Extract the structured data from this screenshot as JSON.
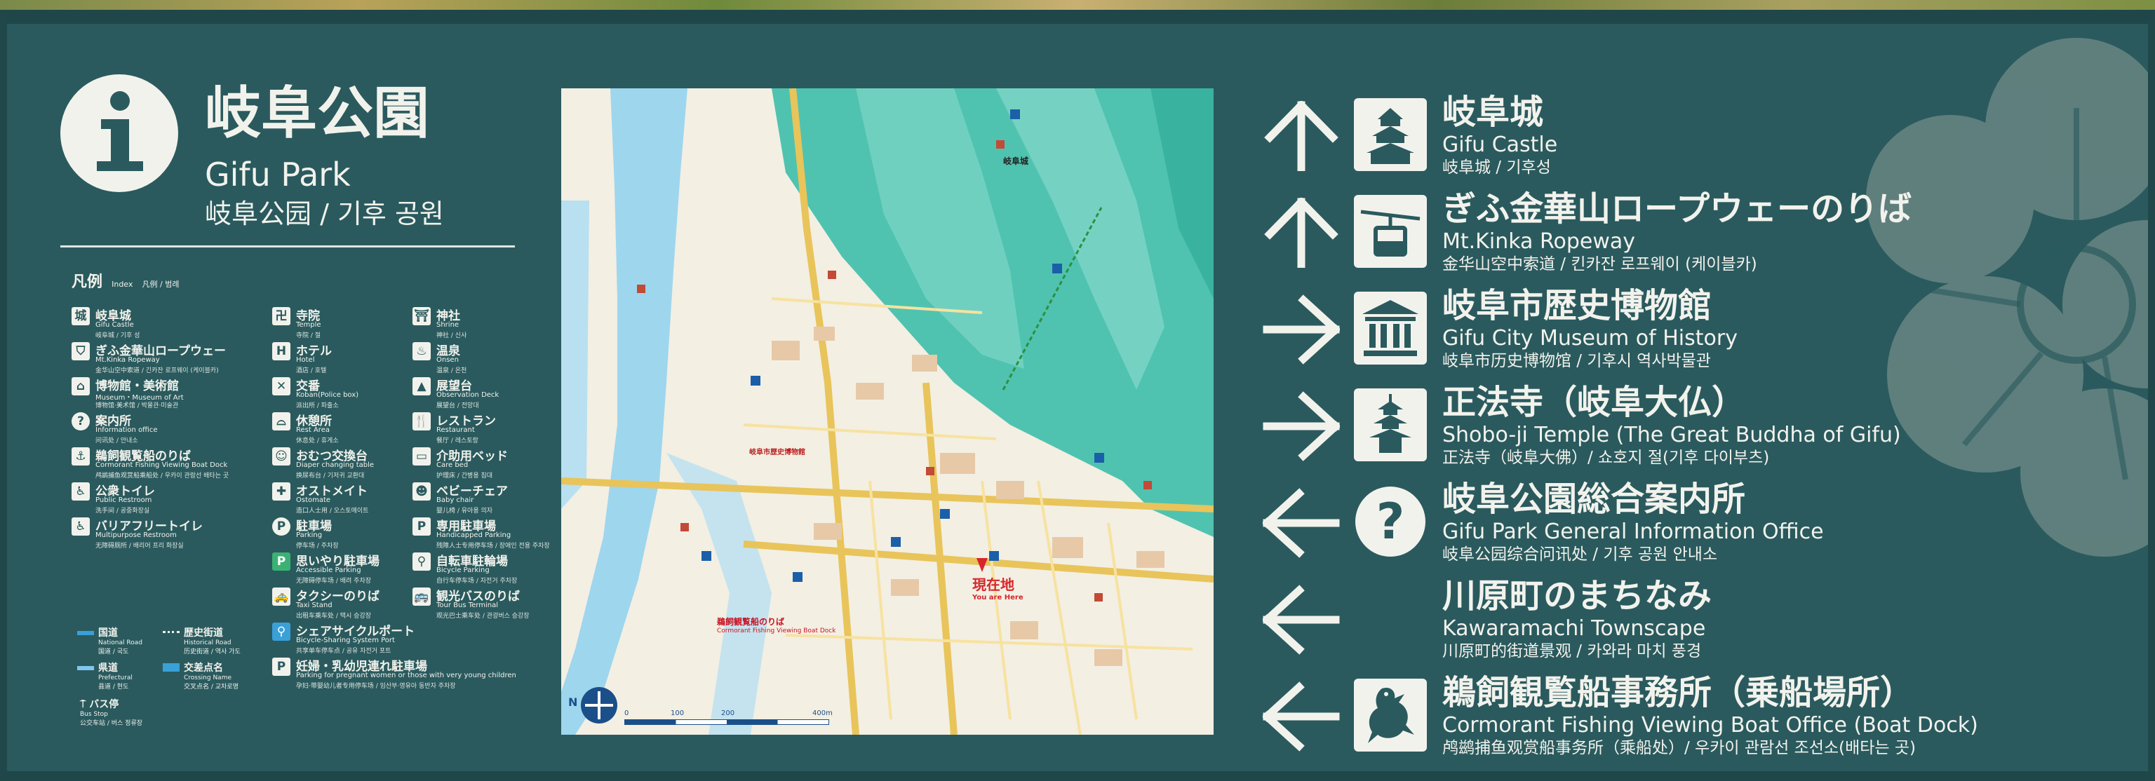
{
  "header": {
    "title_jp": "岐阜公園",
    "title_en": "Gifu Park",
    "title_sub": "岐阜公园 / 기후 공원"
  },
  "legend": {
    "heading": "凡例",
    "heading_en": "Index",
    "heading_ml": "凡例 / 범례",
    "items": [
      {
        "jp": "岐阜城",
        "en": "Gifu Castle",
        "ml": "岐阜城 / 기후 성"
      },
      {
        "jp": "ぎふ金華山ロープウェー",
        "en": "Mt.Kinka Ropeway",
        "ml": "金华山空中索道 / 긴카잔 로프웨이 (케이블카)"
      },
      {
        "jp": "博物館・美術館",
        "en": "Museum・Museum of Art",
        "ml": "博物馆·美术馆 / 박물관·미술관"
      },
      {
        "jp": "案内所",
        "en": "Information office",
        "ml": "问讯处 / 안내소"
      },
      {
        "jp": "鵜飼観覧船のりば",
        "en": "Cormorant Fishing Viewing Boat Dock",
        "ml": "鸬鹚捕鱼观赏船乘船处 / 우카이 관람선 배타는 곳"
      },
      {
        "jp": "公衆トイレ",
        "en": "Public Restroom",
        "ml": "洗手间 / 공중화장실"
      },
      {
        "jp": "バリアフリートイレ",
        "en": "Multipurpose Restroom",
        "ml": "无障碍厕所 / 배리어 프리 화장실"
      },
      {
        "jp": "寺院",
        "en": "Temple",
        "ml": "寺院 / 절"
      },
      {
        "jp": "ホテル",
        "en": "Hotel",
        "ml": "酒店 / 호텔"
      },
      {
        "jp": "交番",
        "en": "Koban(Police box)",
        "ml": "派出所 / 파출소"
      },
      {
        "jp": "休憩所",
        "en": "Rest Area",
        "ml": "休息处 / 휴게소"
      },
      {
        "jp": "おむつ交換台",
        "en": "Diaper changing table",
        "ml": "换尿布台 / 기저귀 교환대"
      },
      {
        "jp": "オストメイト",
        "en": "Ostomate",
        "ml": "造口人士用 / 오스토메이트"
      },
      {
        "jp": "駐車場",
        "en": "Parking",
        "ml": "停车场 / 주차장"
      },
      {
        "jp": "思いやり駐車場",
        "en": "Accessible Parking",
        "ml": "无障碍停车场 / 배려 주차장"
      },
      {
        "jp": "タクシーのりば",
        "en": "Taxi Stand",
        "ml": "出租车乘车处 / 택시 승강장"
      },
      {
        "jp": "シェアサイクルポート",
        "en": "Bicycle-Sharing System Port",
        "ml": "共享单车停车点 / 공유 자전거 포트"
      },
      {
        "jp": "妊婦・乳幼児連れ駐車場",
        "en": "Parking for pregnant women or those with very young children",
        "ml": "孕妇·带婴幼儿者专用停车场 / 임산부·영유아 동반자 주차장"
      },
      {
        "jp": "神社",
        "en": "Shrine",
        "ml": "神社 / 신사"
      },
      {
        "jp": "温泉",
        "en": "Onsen",
        "ml": "温泉 / 온천"
      },
      {
        "jp": "展望台",
        "en": "Observation Deck",
        "ml": "展望台 / 전망대"
      },
      {
        "jp": "レストラン",
        "en": "Restaurant",
        "ml": "餐厅 / 레스토랑"
      },
      {
        "jp": "介助用ベッド",
        "en": "Care bed",
        "ml": "护理床 / 간병용 침대"
      },
      {
        "jp": "ベビーチェア",
        "en": "Baby chair",
        "ml": "婴儿椅 / 유아용 의자"
      },
      {
        "jp": "専用駐車場",
        "en": "Handicapped Parking",
        "ml": "残障人士专用停车场 / 장애인 전용 주차장"
      },
      {
        "jp": "自転車駐輪場",
        "en": "Bicycle Parking",
        "ml": "自行车停车场 / 자전거 주차장"
      },
      {
        "jp": "観光バスのりば",
        "en": "Tour Bus Terminal",
        "ml": "观光巴士乘车处 / 관광버스 승강장"
      }
    ],
    "roads": [
      {
        "jp": "国道",
        "en": "National Road",
        "ml": "国道 / 국도"
      },
      {
        "jp": "県道",
        "en": "Prefectural",
        "ml": "县道 / 현도"
      },
      {
        "jp": "歴史街道",
        "en": "Historical Road",
        "ml": "历史街道 / 역사 가도"
      },
      {
        "jp": "交差点名",
        "en": "Crossing Name",
        "ml": "交叉点名 / 교차로명"
      },
      {
        "jp": "バス停",
        "en": "Bus Stop",
        "ml": "公交车站 / 버스 정류장"
      }
    ]
  },
  "map": {
    "here_jp": "現在地",
    "here_en": "You are Here",
    "kinka": "岐阜城",
    "north": "N",
    "scale_ticks": [
      "0",
      "100",
      "200",
      "400m"
    ],
    "cormorant_jp": "鵜飼観覧船のりば",
    "cormorant_en": "Cormorant Fishing Viewing Boat Dock",
    "museum": "岐阜市歴史博物館"
  },
  "directions": [
    {
      "arrow": "up",
      "icon": "castle-icon",
      "jp": "岐阜城",
      "en": "Gifu Castle",
      "sub": "岐阜城 / 기후성"
    },
    {
      "arrow": "up",
      "icon": "ropeway-icon",
      "jp": "ぎふ金華山ロープウェーのりば",
      "en": "Mt.Kinka Ropeway",
      "sub": "金华山空中索道 / 킨카잔 로프웨이 (케이블카)"
    },
    {
      "arrow": "right",
      "icon": "museum-icon",
      "jp": "岐阜市歴史博物館",
      "en": "Gifu City Museum of History",
      "sub": "岐阜市历史博物馆 / 기후시 역사박물관"
    },
    {
      "arrow": "right",
      "icon": "pagoda-icon",
      "jp": "正法寺（岐阜大仏）",
      "en": "Shobo-ji Temple (The Great Buddha of Gifu)",
      "sub": "正法寺（岐阜大佛）/ 쇼호지 절(기후 다이부츠)"
    },
    {
      "arrow": "left",
      "icon": "question-icon",
      "jp": "岐阜公園総合案内所",
      "en": "Gifu Park General Information Office",
      "sub": "岐阜公园综合问讯处 / 기후 공원 안내소"
    },
    {
      "arrow": "left",
      "icon": "none",
      "jp": "川原町のまちなみ",
      "en": "Kawaramachi Townscape",
      "sub": "川原町的街道景观 / 카와라 마치 풍경"
    },
    {
      "arrow": "left",
      "icon": "cormorant-icon",
      "jp": "鵜飼観覧船事務所（乗船場所）",
      "en": "Cormorant Fishing Viewing Boat Office (Boat Dock)",
      "sub": "鸬鹚捕鱼观赏船事务所（乘船处）/ 우카이 관람선 조선소(배타는 곳)"
    }
  ],
  "colors": {
    "sign": "#2a5a5e",
    "text": "#f2f2ec",
    "map_bg": "#f3efe3",
    "mountain": "#4fc3b0",
    "river": "#9ed6ee",
    "here": "#d6262c"
  }
}
